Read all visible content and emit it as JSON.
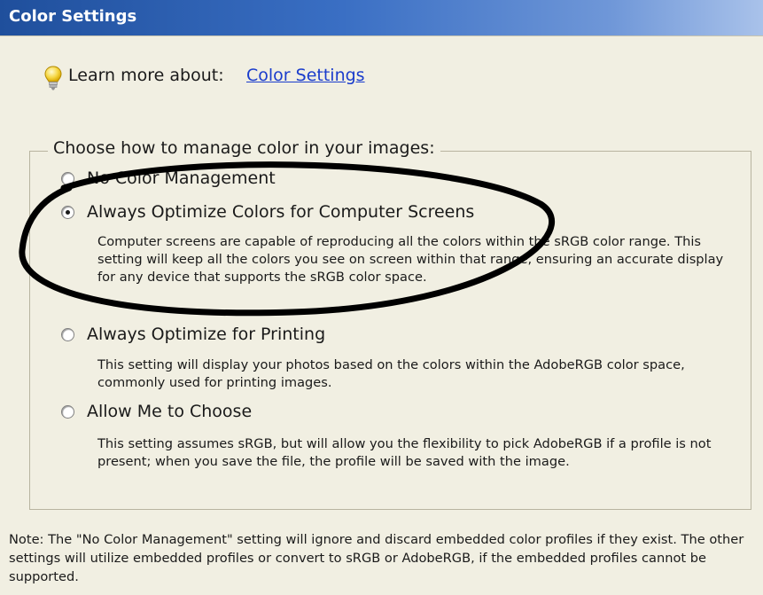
{
  "window": {
    "title": "Color Settings"
  },
  "learn": {
    "text": "Learn more about:",
    "link": "Color Settings",
    "icon": "lightbulb-icon"
  },
  "group": {
    "legend": "Choose how to manage color in your images:",
    "options": [
      {
        "label": "No Color Management",
        "checked": false,
        "description": ""
      },
      {
        "label": "Always Optimize Colors for Computer Screens",
        "checked": true,
        "description": "Computer screens are capable of reproducing all the colors within the sRGB color range. This setting will keep all the colors you see on screen within that range, ensuring an accurate display for any device that supports the sRGB color space."
      },
      {
        "label": "Always Optimize for Printing",
        "checked": false,
        "description": "This setting will display your photos based on the colors within the AdobeRGB color space, commonly used for printing images."
      },
      {
        "label": "Allow Me to Choose",
        "checked": false,
        "description": "This setting assumes sRGB, but will allow you the flexibility to pick AdobeRGB if a profile is not present; when you save the file, the profile will be saved with the image."
      }
    ]
  },
  "note": "Note: The \"No Color Management\" setting will ignore and discard embedded color profiles if they exist. The other settings will utilize embedded profiles or convert to sRGB or AdobeRGB, if the embedded profiles cannot be supported.",
  "colors": {
    "title_bar": "#1f4f9c",
    "dialog_bg": "#f1efe2",
    "link": "#1a3ccc",
    "annotation": "#000000"
  }
}
